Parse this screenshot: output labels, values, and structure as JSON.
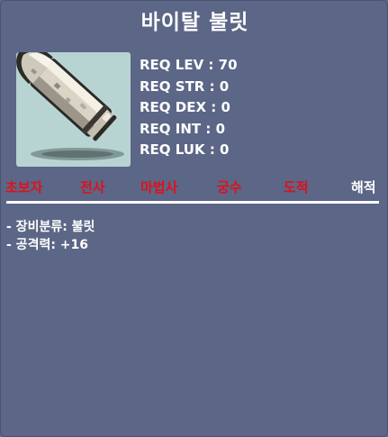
{
  "item": {
    "name": "바이탈 불릿",
    "icon": "bullet-icon",
    "icon_bg_color": "#b8d4d2"
  },
  "requirements": [
    "REQ LEV : 70",
    "REQ STR : 0",
    "REQ DEX : 0",
    "REQ INT : 0",
    "REQ LUK : 0"
  ],
  "jobs": [
    {
      "label": "초보자",
      "color": "#e0101a"
    },
    {
      "label": "전사",
      "color": "#e0101a"
    },
    {
      "label": "마법사",
      "color": "#e0101a"
    },
    {
      "label": "궁수",
      "color": "#e0101a"
    },
    {
      "label": "도적",
      "color": "#e0101a"
    },
    {
      "label": "해적",
      "color": "#ffffff"
    }
  ],
  "description": [
    "- 장비분류: 불릿",
    "- 공격력: +16"
  ],
  "colors": {
    "background": "#5c6686",
    "restricted_job": "#e0101a",
    "allowed_job": "#ffffff"
  }
}
